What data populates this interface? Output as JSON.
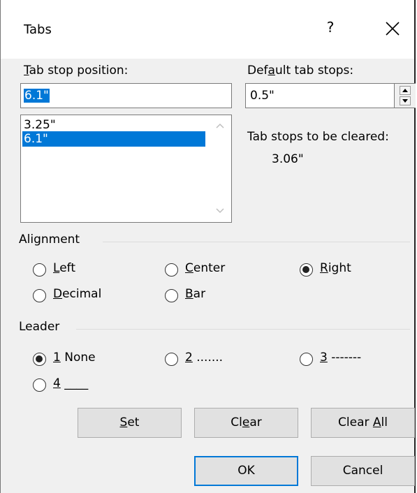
{
  "dialog": {
    "title": "Tabs",
    "help_label": "?",
    "close_icon": "close-icon"
  },
  "tab_stop": {
    "label_prefix": "T",
    "label_rest": "ab stop position:",
    "value": "6.1\"",
    "items": [
      "3.25\"",
      "6.1\""
    ],
    "selected_index": 1
  },
  "default_tab": {
    "label_prefix": "Def",
    "label_u": "a",
    "label_rest": "ult tab stops:",
    "value": "0.5\""
  },
  "cleared": {
    "label": "Tab stops to be cleared:",
    "value": "3.06\""
  },
  "alignment": {
    "heading": "Alignment",
    "options": [
      {
        "u": "L",
        "rest": "eft"
      },
      {
        "u": "C",
        "rest": "enter"
      },
      {
        "u": "R",
        "rest": "ight"
      },
      {
        "u": "D",
        "rest": "ecimal"
      },
      {
        "u": "B",
        "rest": "ar"
      }
    ],
    "selected": "Right"
  },
  "leader": {
    "heading": "Leader",
    "options": [
      {
        "u": "1",
        "rest": " None"
      },
      {
        "u": "2",
        "rest": " ......."
      },
      {
        "u": "3",
        "rest": " -------"
      },
      {
        "u": "4",
        "rest": " ____"
      }
    ],
    "selected": "1 None"
  },
  "buttons": {
    "set": {
      "u": "S",
      "rest": "et"
    },
    "clear": {
      "pre": "Cl",
      "u": "e",
      "rest": "ar"
    },
    "clear_all": {
      "pre": "Clear ",
      "u": "A",
      "rest": "ll"
    },
    "ok": "OK",
    "cancel": "Cancel"
  }
}
